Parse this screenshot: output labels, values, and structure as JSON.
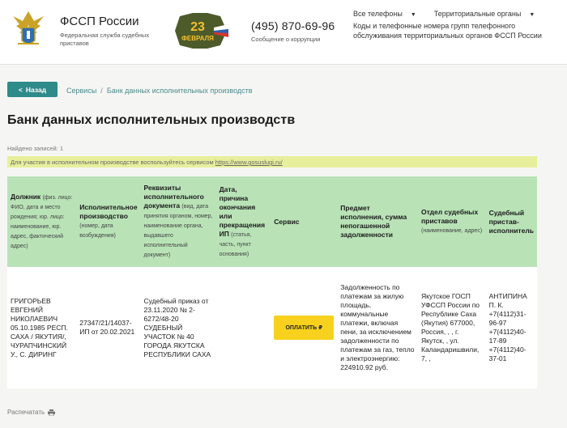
{
  "header": {
    "brand_title": "ФССП России",
    "brand_sub": "Федеральная служба судебных приставов",
    "promo_number": "23",
    "promo_word": "ФЕВРАЛЯ",
    "phone": "(495) 870-69-96",
    "corruption": "Сообщение о коррупции",
    "nav_all_phones": "Все телефоны",
    "nav_territorial": "Территориальные органы",
    "nav_codes": "Коды и телефонные номера групп телефонного обслуживания территориальных органов ФССП России"
  },
  "breadcrumb": {
    "back_label": "Назад",
    "services": "Сервисы",
    "current": "Банк данных исполнительных производств"
  },
  "page_title": "Банк данных исполнительных производств",
  "found": {
    "label": "Найдено записей:",
    "count": "1"
  },
  "notice": {
    "text": "Для участия в исполнительном производстве воспользуйтесь сервисом",
    "link": "https://www.gosuslugi.ru/"
  },
  "table": {
    "headers": [
      {
        "title": "Должник",
        "sub": "(физ. лицо: ФИО, дата и место рождения; юр. лицо: наименование, юр. адрес, фактический адрес)"
      },
      {
        "title": "Исполнительное производство",
        "sub": "(номер, дата возбуждения)"
      },
      {
        "title": "Реквизиты исполнительного документа",
        "sub": "(вид, дата принятия органом, номер, наименование органа, выдавшего исполнительный документ)"
      },
      {
        "title": "Дата, причина окончания или прекращения ИП",
        "sub": "(статья, часть, пункт основания)"
      },
      {
        "title": "Сервис",
        "sub": ""
      },
      {
        "title": "Предмет исполнения, сумма непогашенной задолженности",
        "sub": ""
      },
      {
        "title": "Отдел судебных приставов",
        "sub": "(наименование, адрес)"
      },
      {
        "title": "Судебный пристав-исполнитель",
        "sub": ""
      }
    ],
    "row": {
      "debtor": "ГРИГОРЬЕВ ЕВГЕНИЙ НИКОЛАЕВИЧ 05.10.1985 РЕСП. САХА / ЯКУТИЯ/, ЧУРАПЧИНСКИЙ У., С. ДИРИНГ",
      "proceeding": "27347/21/14037-ИП от 20.02.2021",
      "document": "Судебный приказ от 23.11.2020 № 2-6272/48-20 СУДЕБНЫЙ УЧАСТОК № 40 ГОРОДА ЯКУТСКА РЕСПУБЛИКИ САХА",
      "end": "",
      "pay_label": "ОПЛАТИТЬ",
      "subject": "Задолженность по платежам за жилую площадь, коммунальные платежи, включая пени, за исключением задолженности по платежам за газ, тепло и электроэнергию: 224910.92 руб.",
      "department": "Якутское ГОСП УФССП России по Республике Саха (Якутия) 677000, Россия, , , г. Якутск, , ул. Каландаришвили, 7, ,",
      "bailiff": "АНТИПИНА П. К. +7(4112)31-96-97 +7(4112)40-17-89 +7(4112)40-37-01"
    }
  },
  "print_label": "Распечатать",
  "colors": {
    "accent": "#2f8a8a",
    "header_green": "#b9e3b7",
    "notice_yellow": "#e7ef9c",
    "pay_yellow": "#f7d11d"
  }
}
